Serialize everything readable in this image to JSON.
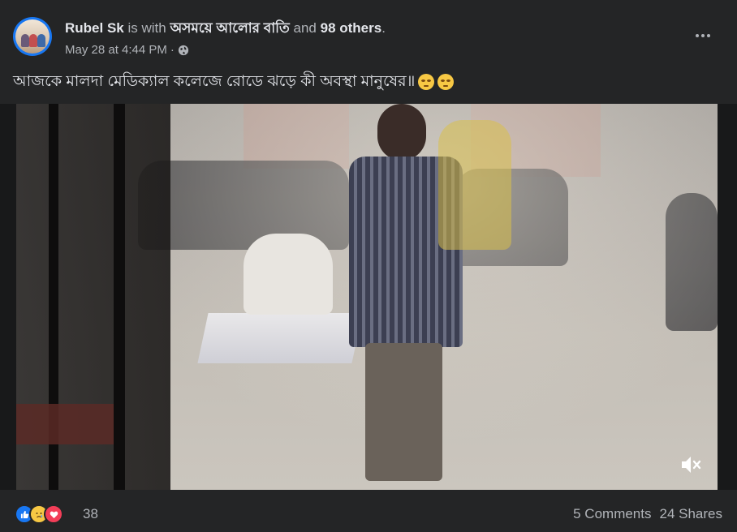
{
  "post": {
    "author": "Rubel Sk",
    "with_text": "is with",
    "group": "অসময়ে আলোর বাতি",
    "and_text": "and",
    "others": "98 others",
    "period": ".",
    "timestamp": "May 28 at 4:44 PM",
    "separator": "·",
    "privacy_icon": "globe-icon",
    "caption": "আজকে মালদা মেডিক্যাল কলেজে রোডে ঝড়ে কী অবস্থা মানুষের॥",
    "caption_emojis": [
      "rolling-eyes-emoji",
      "rolling-eyes-emoji"
    ]
  },
  "video": {
    "mute_icon": "speaker-muted-icon"
  },
  "footer": {
    "reactions": [
      "like",
      "sad",
      "love"
    ],
    "reaction_count": "38",
    "comments": "5 Comments",
    "shares": "24 Shares"
  },
  "colors": {
    "background": "#242526",
    "text": "#e4e6eb",
    "muted": "#b0b3b8",
    "like": "#1877f2",
    "love": "#f33e58",
    "sad": "#f7c844"
  }
}
